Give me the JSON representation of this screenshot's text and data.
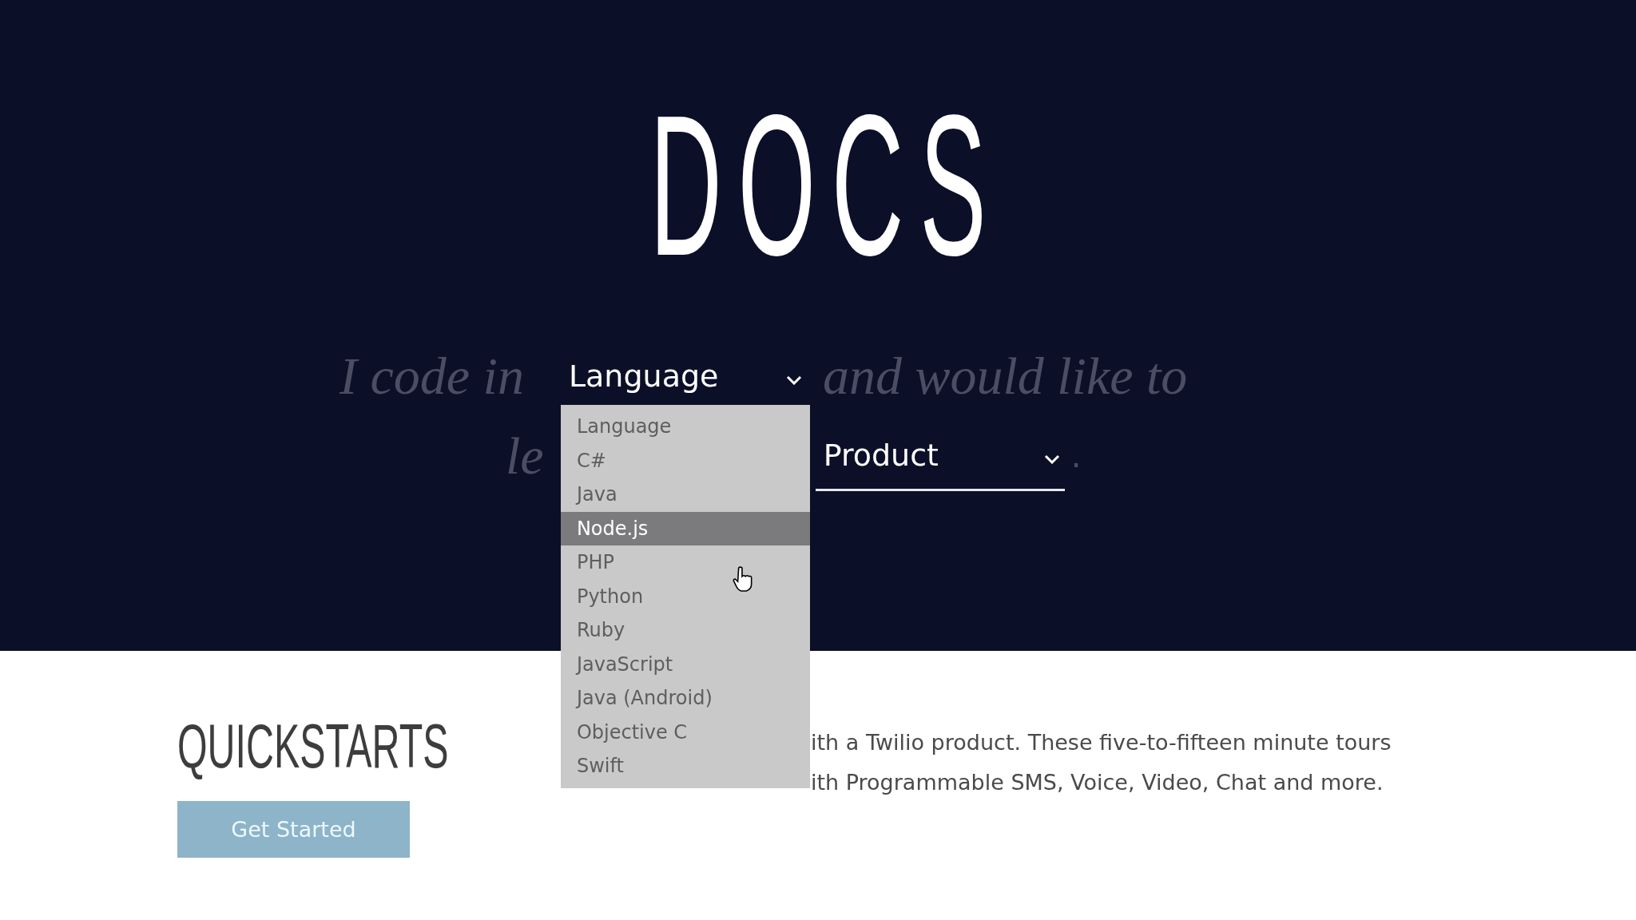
{
  "title": "DOCS",
  "sentence": {
    "lead": "I code in",
    "language_select": {
      "value": "Language"
    },
    "middle": "and would like to",
    "line2_start": "le",
    "product_select": {
      "value": "Product"
    },
    "end": "."
  },
  "language_options": [
    {
      "label": "Language",
      "selected": false
    },
    {
      "label": "C#",
      "selected": false
    },
    {
      "label": "Java",
      "selected": false
    },
    {
      "label": "Node.js",
      "selected": true
    },
    {
      "label": "PHP",
      "selected": false
    },
    {
      "label": "Python",
      "selected": false
    },
    {
      "label": "Ruby",
      "selected": false
    },
    {
      "label": "JavaScript",
      "selected": false
    },
    {
      "label": "Java (Android)",
      "selected": false
    },
    {
      "label": "Objective C",
      "selected": false
    },
    {
      "label": "Swift",
      "selected": false
    }
  ],
  "quickstarts": {
    "title": "QUICKSTARTS",
    "button": "Get Started",
    "description_lines": [
      "ith a Twilio product. These five-to-fifteen minute tours",
      "ith Programmable SMS, Voice, Video, Chat and more."
    ]
  }
}
